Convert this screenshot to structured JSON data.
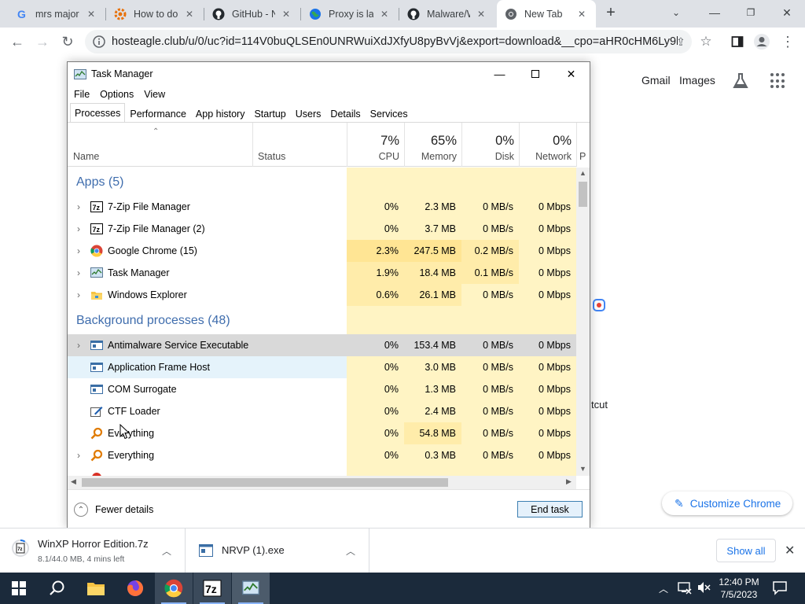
{
  "browser": {
    "tabs": [
      {
        "title": "mrs major",
        "icon": "google-g-icon"
      },
      {
        "title": "How to do",
        "icon": "orange-gear-icon"
      },
      {
        "title": "GitHub - N",
        "icon": "github-icon"
      },
      {
        "title": "Proxy is la",
        "icon": "globe-icon"
      },
      {
        "title": "Malware/W",
        "icon": "github-icon"
      },
      {
        "title": "New Tab",
        "icon": "chrome-icon"
      }
    ],
    "url": "hosteagle.club/u/0/uc?id=114V0buQLSEn0UNRWuiXdJXfyU8pyBvVj&export=download&__cpo=aHR0cHM6Ly9k...",
    "ntp_links": {
      "gmail": "Gmail",
      "images": "Images"
    },
    "customize_label": "Customize Chrome",
    "partial_text": "tcut"
  },
  "task_manager": {
    "title": "Task Manager",
    "menu": [
      "File",
      "Options",
      "View"
    ],
    "tabs": [
      "Processes",
      "Performance",
      "App history",
      "Startup",
      "Users",
      "Details",
      "Services"
    ],
    "active_tab": "Processes",
    "columns": {
      "name": "Name",
      "status": "Status",
      "cpu": {
        "pct": "7%",
        "label": "CPU"
      },
      "memory": {
        "pct": "65%",
        "label": "Memory"
      },
      "disk": {
        "pct": "0%",
        "label": "Disk"
      },
      "network": {
        "pct": "0%",
        "label": "Network"
      },
      "power": "P"
    },
    "groups": {
      "apps": "Apps (5)",
      "background": "Background processes (48)"
    },
    "apps": [
      {
        "name": "7-Zip File Manager",
        "cpu": "0%",
        "mem": "2.3 MB",
        "disk": "0 MB/s",
        "net": "0 Mbps"
      },
      {
        "name": "7-Zip File Manager (2)",
        "cpu": "0%",
        "mem": "3.7 MB",
        "disk": "0 MB/s",
        "net": "0 Mbps"
      },
      {
        "name": "Google Chrome (15)",
        "cpu": "2.3%",
        "mem": "247.5 MB",
        "disk": "0.2 MB/s",
        "net": "0 Mbps"
      },
      {
        "name": "Task Manager",
        "cpu": "1.9%",
        "mem": "18.4 MB",
        "disk": "0.1 MB/s",
        "net": "0 Mbps"
      },
      {
        "name": "Windows Explorer",
        "cpu": "0.6%",
        "mem": "26.1 MB",
        "disk": "0 MB/s",
        "net": "0 Mbps"
      }
    ],
    "background": [
      {
        "name": "Antimalware Service Executable",
        "cpu": "0%",
        "mem": "153.4 MB",
        "disk": "0 MB/s",
        "net": "0 Mbps"
      },
      {
        "name": "Application Frame Host",
        "cpu": "0%",
        "mem": "3.0 MB",
        "disk": "0 MB/s",
        "net": "0 Mbps"
      },
      {
        "name": "COM Surrogate",
        "cpu": "0%",
        "mem": "1.3 MB",
        "disk": "0 MB/s",
        "net": "0 Mbps"
      },
      {
        "name": "CTF Loader",
        "cpu": "0%",
        "mem": "2.4 MB",
        "disk": "0 MB/s",
        "net": "0 Mbps"
      },
      {
        "name": "Everything",
        "cpu": "0%",
        "mem": "54.8 MB",
        "disk": "0 MB/s",
        "net": "0 Mbps"
      },
      {
        "name": "Everything",
        "cpu": "0%",
        "mem": "0.3 MB",
        "disk": "0 MB/s",
        "net": "0 Mbps"
      }
    ],
    "fewer_details": "Fewer details",
    "end_task": "End task"
  },
  "downloads": [
    {
      "name": "WinXP Horror Edition.7z",
      "sub": "8.1/44.0 MB, 4 mins left"
    },
    {
      "name": "NRVP (1).exe",
      "sub": ""
    }
  ],
  "show_all": "Show all",
  "taskbar": {
    "time": "12:40 PM",
    "date": "7/5/2023"
  }
}
